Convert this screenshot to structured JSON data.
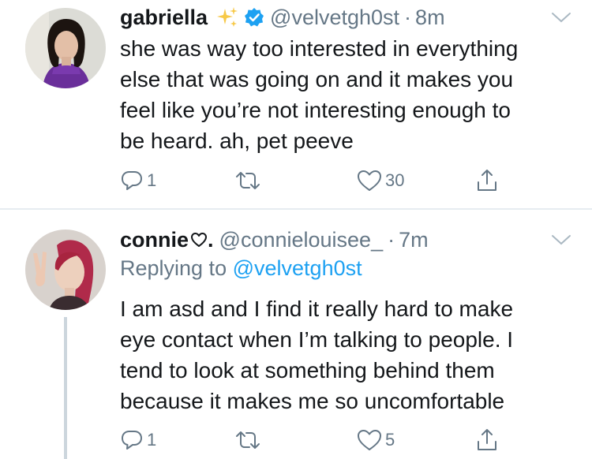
{
  "colors": {
    "name": "#14171a",
    "secondary": "#657786",
    "link": "#1da1f2",
    "verified": "#1da1f2",
    "divider": "#e6ecf0",
    "thread_line": "#ccd6dd"
  },
  "tweets": [
    {
      "avatar": "profile-photo",
      "name": "gabriella",
      "name_emoji": "sparkles-icon",
      "verified": true,
      "handle": "@velvetgh0st",
      "separator": "·",
      "time": "8m",
      "lines": [
        "she was way too interested in everything",
        "else that was going on and it makes you",
        "feel like you’re not interesting enough to",
        "be heard. ah, pet peeve"
      ],
      "actions": {
        "reply_count": "1",
        "retweet_count": "",
        "like_count": "30"
      }
    },
    {
      "avatar": "profile-photo",
      "name": "connie",
      "name_emoji": "heart-outline-icon",
      "name_suffix": ".",
      "verified": false,
      "handle": "@connielouisee_",
      "separator": "·",
      "time": "7m",
      "replying_prefix": "Replying to",
      "replying_to": "@velvetgh0st",
      "lines": [
        "I am asd and I find it really hard to make",
        "eye contact when I’m talking to people. I",
        "tend to look at something behind them",
        "because it makes me so uncomfortable"
      ],
      "actions": {
        "reply_count": "1",
        "retweet_count": "",
        "like_count": "5"
      }
    }
  ]
}
